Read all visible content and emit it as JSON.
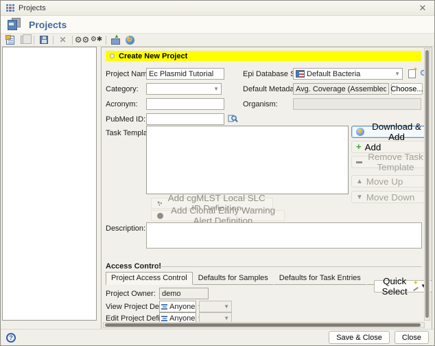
{
  "window": {
    "title": "Projects",
    "close_symbol": "✕"
  },
  "header": {
    "title": "Projects"
  },
  "toolbar": {
    "icons": [
      "new-project",
      "copy",
      "save",
      "delete",
      "manage-task-templates",
      "run-task",
      "import-box",
      "refresh"
    ]
  },
  "banner": {
    "title": "Create New Project"
  },
  "form": {
    "project_name": {
      "label": "Project Name:",
      "value": "Ec Plasmid Tutorial"
    },
    "category": {
      "label": "Category:",
      "value": ""
    },
    "acronym": {
      "label": "Acronym:",
      "value": ""
    },
    "pubmed_id": {
      "label": "PubMed ID:",
      "value": ""
    },
    "epi_database_scheme": {
      "label": "Epi Database Scheme:",
      "value": "Default Bacteria"
    },
    "default_metadata_fields": {
      "label": "Default Metadata Fields:",
      "value": "Avg. Coverage (Assembled), Approximated Ge",
      "choose_label": "Choose..."
    },
    "organism": {
      "label": "Organism:",
      "value": ""
    },
    "task_templates": {
      "label": "Task Templates:",
      "buttons": {
        "download_add": "Download & Add",
        "add": "Add",
        "remove": "Remove Task Template",
        "move_up": "Move Up",
        "move_down": "Move Down"
      },
      "extra": {
        "cgmlst": "Add cgMLST Local SLC ID Definition",
        "clonal": "Add Clonal Early Warning Alert Definition"
      }
    },
    "description": {
      "label": "Description:",
      "value": ""
    }
  },
  "access_control": {
    "group_label": "Access Control",
    "tabs": [
      {
        "label": "Project Access Control",
        "active": true
      },
      {
        "label": "Defaults for Samples",
        "active": false
      },
      {
        "label": "Defaults for Task Entries",
        "active": false
      }
    ],
    "quick_select_label": "Quick Select",
    "project_owner": {
      "label": "Project Owner:",
      "value": "demo"
    },
    "view_project_definition": {
      "label": "View Project Definition:",
      "value": "Anyone"
    },
    "edit_project_definition": {
      "label": "Edit Project Definition:",
      "value": "Anyone"
    }
  },
  "footer": {
    "save_and_close": "Save & Close",
    "close": "Close"
  },
  "colors": {
    "banner_bg": "#ffff00",
    "title_text": "#44679c",
    "focus_border": "#5e93c8",
    "add_green": "#3aa13f"
  }
}
